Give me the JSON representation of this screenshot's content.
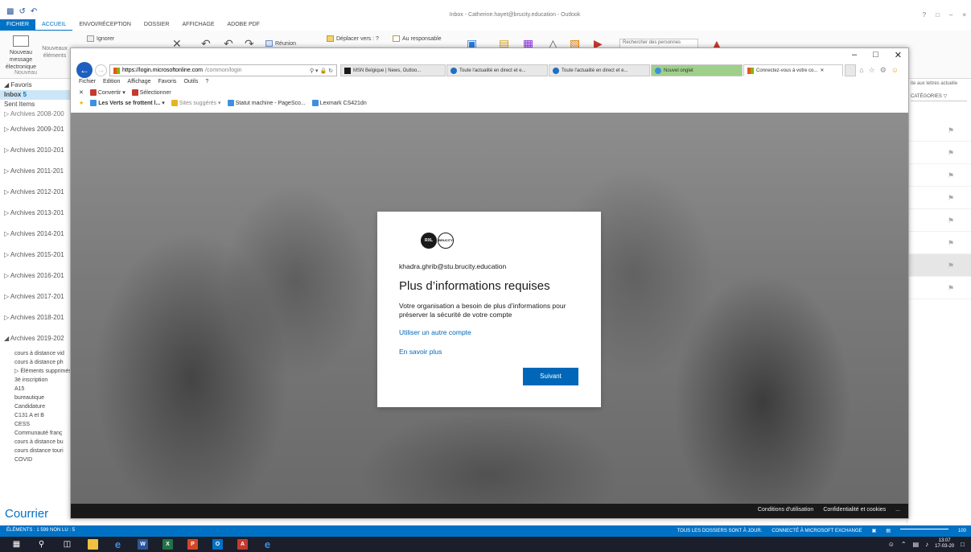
{
  "outlook": {
    "title": "Inbox - Catherine.hayet@brucity.education - Outlook",
    "window_controls": [
      "?",
      "□",
      "–",
      "×"
    ],
    "tabs": [
      "FICHIER",
      "ACCUEIL",
      "ENVOI/RÉCEPTION",
      "DOSSIER",
      "AFFICHAGE",
      "ADOBE PDF"
    ],
    "ribbon": {
      "new_mail": "Nouveau message",
      "new_mail_2": "électronique",
      "new_items": "Nouveaux éléments",
      "group_new": "Nouveau",
      "ignore": "Ignorer",
      "reunion": "Réunion",
      "move_to": "Déplacer vers : ?",
      "to_manager": "Au responsable",
      "search_people": "Rechercher des personnes"
    },
    "folders": {
      "favoris": "◢ Favoris",
      "inbox": "Inbox",
      "inbox_count": "5",
      "sent": "Sent Items",
      "archives": [
        "▷ Archives 2008-200",
        "▷ Archives 2009-201",
        "▷ Archives 2010-201",
        "▷ Archives 2011-201",
        "▷ Archives 2012-201",
        "▷ Archives 2013-201",
        "▷ Archives 2014-201",
        "▷ Archives 2015-201",
        "▷ Archives 2016-201",
        "▷ Archives 2017-201",
        "▷ Archives 2018-201",
        "◢ Archives 2019-202"
      ],
      "subfolders": [
        "cours à distance vid",
        "cours à distance ph",
        "▷ Éléments supprimés",
        "3è inscription",
        "A15",
        "bureautique",
        "Candidature",
        "C131 A et B",
        "CESS",
        "Communauté franç",
        "cours à distance bu",
        "cours distance touri",
        "COVID"
      ],
      "courrier": "Courrier"
    },
    "right_pane": {
      "hint": "ite aux lettres actuelle",
      "categories": "CATÉGORIES"
    },
    "status": {
      "left": "ÉLÉMENTS : 1 599   NON LU : 5",
      "sync": "TOUS LES DOSSIERS SONT À JOUR.",
      "exchange": "CONNECTÉ À MICROSOFT EXCHANGE",
      "zoom": "100"
    }
  },
  "taskbar": {
    "time": "13:07",
    "date": "17-03-20"
  },
  "ie": {
    "address_host": "https://login.microsoftonline.com",
    "address_path": "/common/login",
    "tabs": [
      "MSN Belgique | News, Outloo...",
      "Toute l'actualité en direct et e...",
      "Toute l'actualité en direct et e...",
      "Nouvel onglet",
      "Connectez-vous à votre co..."
    ],
    "menu": [
      "Fichier",
      "Edition",
      "Affichage",
      "Favoris",
      "Outils",
      "?"
    ],
    "command_bar": [
      "Convertir",
      "Sélectionner"
    ],
    "favorites": [
      "Les Verts se frottent l...",
      "Sites suggérés",
      "Statut machine - PageSco...",
      "Lexmark CS421dn"
    ],
    "footer": [
      "Conditions d'utilisation",
      "Confidentialité et cookies",
      "..."
    ]
  },
  "login": {
    "logo_left": "RXL",
    "logo_right": "BRUCITY",
    "user": "khadra.ghrib@stu.brucity.education",
    "title": "Plus d’informations requises",
    "description": "Votre organisation a besoin de plus d’informations pour préserver la sécurité de votre compte",
    "link_other_account": "Utiliser un autre compte",
    "link_learn_more": "En savoir plus",
    "next_button": "Suivant"
  },
  "colors": {
    "outlook_blue": "#0072c6",
    "ms_link": "#0067b8",
    "ms_button": "#0067b8",
    "taskbar": "#1b1f2b"
  }
}
